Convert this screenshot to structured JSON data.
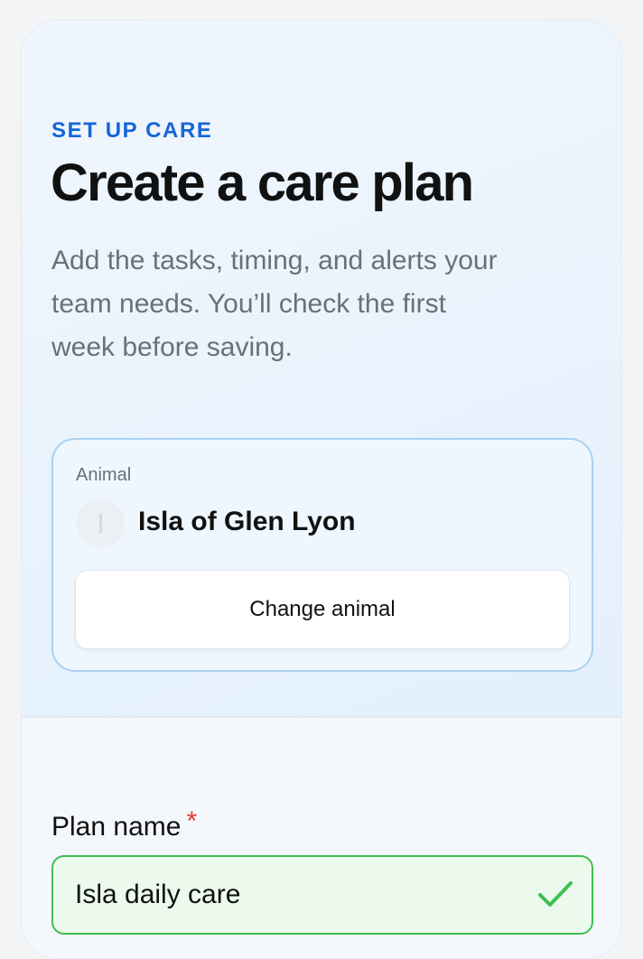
{
  "header": {
    "eyebrow": "SET UP CARE",
    "title": "Create a care plan",
    "description": "Add the tasks, timing, and alerts your team needs. You’ll check the first week before saving."
  },
  "animal": {
    "label": "Animal",
    "name": "Isla of Glen Lyon",
    "change_label": "Change animal"
  },
  "form": {
    "plan_name_label": "Plan name",
    "required_marker": "*",
    "plan_name_value": "Isla daily care"
  },
  "colors": {
    "accent": "#1565d8",
    "success": "#3fbf52",
    "required": "#e53935"
  },
  "icons": {
    "avatar": "avatar-placeholder",
    "valid": "check-icon"
  }
}
